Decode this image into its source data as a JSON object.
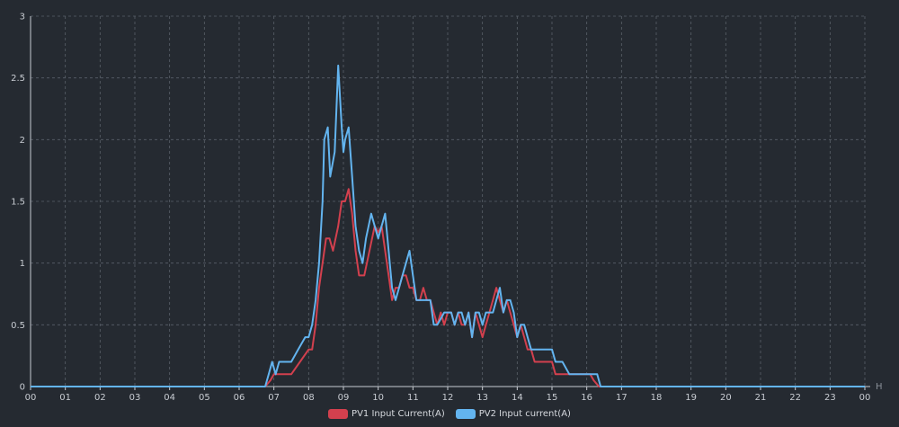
{
  "chart_data": {
    "type": "line",
    "x_unit": "H",
    "x_ticks": [
      "00",
      "01",
      "02",
      "03",
      "04",
      "05",
      "06",
      "07",
      "08",
      "09",
      "10",
      "11",
      "12",
      "13",
      "14",
      "15",
      "16",
      "17",
      "18",
      "19",
      "20",
      "21",
      "22",
      "23",
      "00"
    ],
    "y_ticks": [
      "0",
      "0.5",
      "1",
      "1.5",
      "2",
      "2.5",
      "3"
    ],
    "ylim": [
      0,
      3
    ],
    "xlim": [
      0,
      24
    ],
    "grid": true,
    "legend_position": "bottom-center",
    "series": [
      {
        "name": "PV1 Input Current(A)",
        "color": "#d2404e",
        "points": [
          [
            0,
            0
          ],
          [
            6.75,
            0
          ],
          [
            6.9,
            0.05
          ],
          [
            7.0,
            0.1
          ],
          [
            7.25,
            0.1
          ],
          [
            7.5,
            0.1
          ],
          [
            7.75,
            0.2
          ],
          [
            8.0,
            0.3
          ],
          [
            8.1,
            0.3
          ],
          [
            8.2,
            0.5
          ],
          [
            8.3,
            0.8
          ],
          [
            8.4,
            1.0
          ],
          [
            8.5,
            1.2
          ],
          [
            8.6,
            1.2
          ],
          [
            8.7,
            1.1
          ],
          [
            8.85,
            1.3
          ],
          [
            8.95,
            1.5
          ],
          [
            9.05,
            1.5
          ],
          [
            9.15,
            1.6
          ],
          [
            9.25,
            1.4
          ],
          [
            9.35,
            1.1
          ],
          [
            9.45,
            0.9
          ],
          [
            9.6,
            0.9
          ],
          [
            9.75,
            1.1
          ],
          [
            9.9,
            1.3
          ],
          [
            10.0,
            1.25
          ],
          [
            10.1,
            1.3
          ],
          [
            10.2,
            1.1
          ],
          [
            10.3,
            0.9
          ],
          [
            10.4,
            0.7
          ],
          [
            10.5,
            0.8
          ],
          [
            10.6,
            0.8
          ],
          [
            10.7,
            0.9
          ],
          [
            10.8,
            0.9
          ],
          [
            10.9,
            0.8
          ],
          [
            11.0,
            0.8
          ],
          [
            11.1,
            0.7
          ],
          [
            11.2,
            0.7
          ],
          [
            11.3,
            0.8
          ],
          [
            11.4,
            0.7
          ],
          [
            11.5,
            0.7
          ],
          [
            11.6,
            0.6
          ],
          [
            11.7,
            0.5
          ],
          [
            11.8,
            0.6
          ],
          [
            11.9,
            0.5
          ],
          [
            12.0,
            0.6
          ],
          [
            12.1,
            0.6
          ],
          [
            12.2,
            0.5
          ],
          [
            12.3,
            0.6
          ],
          [
            12.4,
            0.5
          ],
          [
            12.5,
            0.5
          ],
          [
            12.6,
            0.6
          ],
          [
            12.7,
            0.4
          ],
          [
            12.8,
            0.6
          ],
          [
            12.9,
            0.5
          ],
          [
            13.0,
            0.4
          ],
          [
            13.1,
            0.5
          ],
          [
            13.2,
            0.6
          ],
          [
            13.3,
            0.7
          ],
          [
            13.4,
            0.8
          ],
          [
            13.5,
            0.7
          ],
          [
            13.6,
            0.6
          ],
          [
            13.7,
            0.7
          ],
          [
            13.8,
            0.6
          ],
          [
            13.9,
            0.5
          ],
          [
            14.0,
            0.4
          ],
          [
            14.1,
            0.5
          ],
          [
            14.2,
            0.4
          ],
          [
            14.3,
            0.3
          ],
          [
            14.4,
            0.3
          ],
          [
            14.5,
            0.2
          ],
          [
            14.7,
            0.2
          ],
          [
            14.9,
            0.2
          ],
          [
            15.0,
            0.2
          ],
          [
            15.1,
            0.1
          ],
          [
            15.3,
            0.1
          ],
          [
            15.5,
            0.1
          ],
          [
            15.7,
            0.1
          ],
          [
            15.9,
            0.1
          ],
          [
            16.1,
            0.1
          ],
          [
            16.2,
            0.05
          ],
          [
            16.35,
            0
          ],
          [
            24,
            0
          ]
        ]
      },
      {
        "name": "PV2 Input current(A)",
        "color": "#63b4ef",
        "points": [
          [
            0,
            0
          ],
          [
            6.75,
            0
          ],
          [
            6.85,
            0.1
          ],
          [
            6.95,
            0.2
          ],
          [
            7.05,
            0.1
          ],
          [
            7.15,
            0.2
          ],
          [
            7.3,
            0.2
          ],
          [
            7.5,
            0.2
          ],
          [
            7.7,
            0.3
          ],
          [
            7.9,
            0.4
          ],
          [
            8.0,
            0.4
          ],
          [
            8.1,
            0.5
          ],
          [
            8.2,
            0.7
          ],
          [
            8.3,
            1.0
          ],
          [
            8.4,
            1.5
          ],
          [
            8.45,
            2.0
          ],
          [
            8.55,
            2.1
          ],
          [
            8.62,
            1.7
          ],
          [
            8.75,
            1.9
          ],
          [
            8.85,
            2.6
          ],
          [
            8.95,
            2.1
          ],
          [
            9.0,
            1.9
          ],
          [
            9.05,
            2.0
          ],
          [
            9.15,
            2.1
          ],
          [
            9.25,
            1.7
          ],
          [
            9.35,
            1.3
          ],
          [
            9.45,
            1.1
          ],
          [
            9.55,
            1.0
          ],
          [
            9.65,
            1.2
          ],
          [
            9.8,
            1.4
          ],
          [
            9.9,
            1.3
          ],
          [
            10.0,
            1.2
          ],
          [
            10.1,
            1.3
          ],
          [
            10.2,
            1.4
          ],
          [
            10.3,
            1.1
          ],
          [
            10.4,
            0.8
          ],
          [
            10.5,
            0.7
          ],
          [
            10.6,
            0.8
          ],
          [
            10.7,
            0.9
          ],
          [
            10.8,
            1.0
          ],
          [
            10.9,
            1.1
          ],
          [
            11.0,
            0.9
          ],
          [
            11.1,
            0.7
          ],
          [
            11.2,
            0.7
          ],
          [
            11.3,
            0.7
          ],
          [
            11.4,
            0.7
          ],
          [
            11.5,
            0.7
          ],
          [
            11.6,
            0.5
          ],
          [
            11.7,
            0.5
          ],
          [
            11.8,
            0.55
          ],
          [
            11.9,
            0.6
          ],
          [
            12.0,
            0.6
          ],
          [
            12.1,
            0.6
          ],
          [
            12.2,
            0.5
          ],
          [
            12.3,
            0.6
          ],
          [
            12.4,
            0.6
          ],
          [
            12.5,
            0.5
          ],
          [
            12.6,
            0.6
          ],
          [
            12.7,
            0.4
          ],
          [
            12.8,
            0.6
          ],
          [
            12.9,
            0.6
          ],
          [
            13.0,
            0.5
          ],
          [
            13.1,
            0.6
          ],
          [
            13.2,
            0.6
          ],
          [
            13.3,
            0.6
          ],
          [
            13.4,
            0.7
          ],
          [
            13.5,
            0.8
          ],
          [
            13.6,
            0.6
          ],
          [
            13.7,
            0.7
          ],
          [
            13.8,
            0.7
          ],
          [
            13.9,
            0.6
          ],
          [
            14.0,
            0.4
          ],
          [
            14.1,
            0.5
          ],
          [
            14.2,
            0.5
          ],
          [
            14.3,
            0.4
          ],
          [
            14.4,
            0.3
          ],
          [
            14.6,
            0.3
          ],
          [
            14.8,
            0.3
          ],
          [
            15.0,
            0.3
          ],
          [
            15.1,
            0.2
          ],
          [
            15.3,
            0.2
          ],
          [
            15.5,
            0.1
          ],
          [
            15.7,
            0.1
          ],
          [
            15.9,
            0.1
          ],
          [
            16.1,
            0.1
          ],
          [
            16.3,
            0.1
          ],
          [
            16.4,
            0
          ],
          [
            24,
            0
          ]
        ]
      }
    ]
  }
}
